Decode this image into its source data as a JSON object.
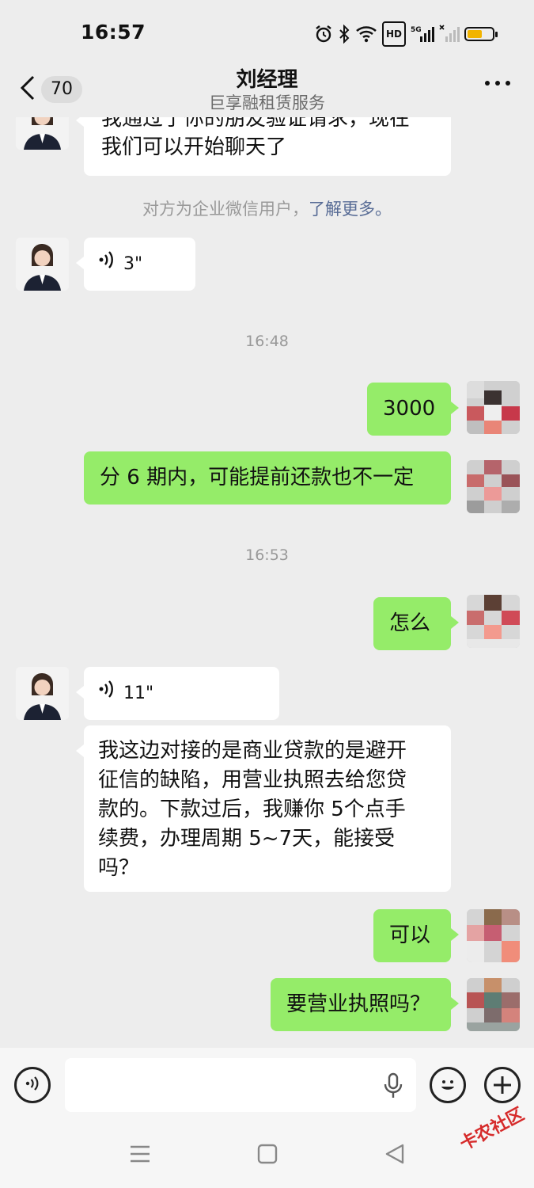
{
  "status_bar": {
    "time": "16:57",
    "network": "5G",
    "hd": "HD",
    "battery_level": 0.6,
    "battery_color": "#f2b400"
  },
  "header": {
    "back_count": "70",
    "title": "刘经理",
    "subtitle": "巨享融租赁服务"
  },
  "chat": {
    "first_message": [
      "我通过了你的朋友验证请求，现在",
      "我们可以开始聊天了"
    ],
    "notice_text": "对方为企业微信用户，",
    "notice_link": "了解更多。",
    "voice_1": "3\"",
    "time_1": "16:48",
    "sent_1": "3000",
    "sent_2": "分 6 期内，可能提前还款也不一定",
    "time_2": "16:53",
    "sent_3": "怎么",
    "voice_2": "11\"",
    "long_message": [
      "我这边对接的是商业贷款的是避开",
      "征信的缺陷，用营业执照去给您贷",
      "款的。下款过后，我赚你 5个点手",
      "续费，办理周期 5~7天，能接受",
      "吗？"
    ],
    "sent_4": "可以",
    "sent_5": "要营业执照吗？"
  },
  "colors": {
    "sent_bubble": "#95ec69",
    "received_bubble": "#ffffff",
    "background": "#ededed",
    "link": "#576b95"
  },
  "icons": [
    "back-chevron-icon",
    "more-dots-icon",
    "voice-wave-icon",
    "mic-icon",
    "emoji-icon",
    "plus-icon",
    "nav-menu-icon",
    "nav-home-icon",
    "nav-back-icon",
    "alarm-icon",
    "bluetooth-icon",
    "wifi-icon",
    "signal-icon"
  ],
  "watermark": "卡农社区"
}
